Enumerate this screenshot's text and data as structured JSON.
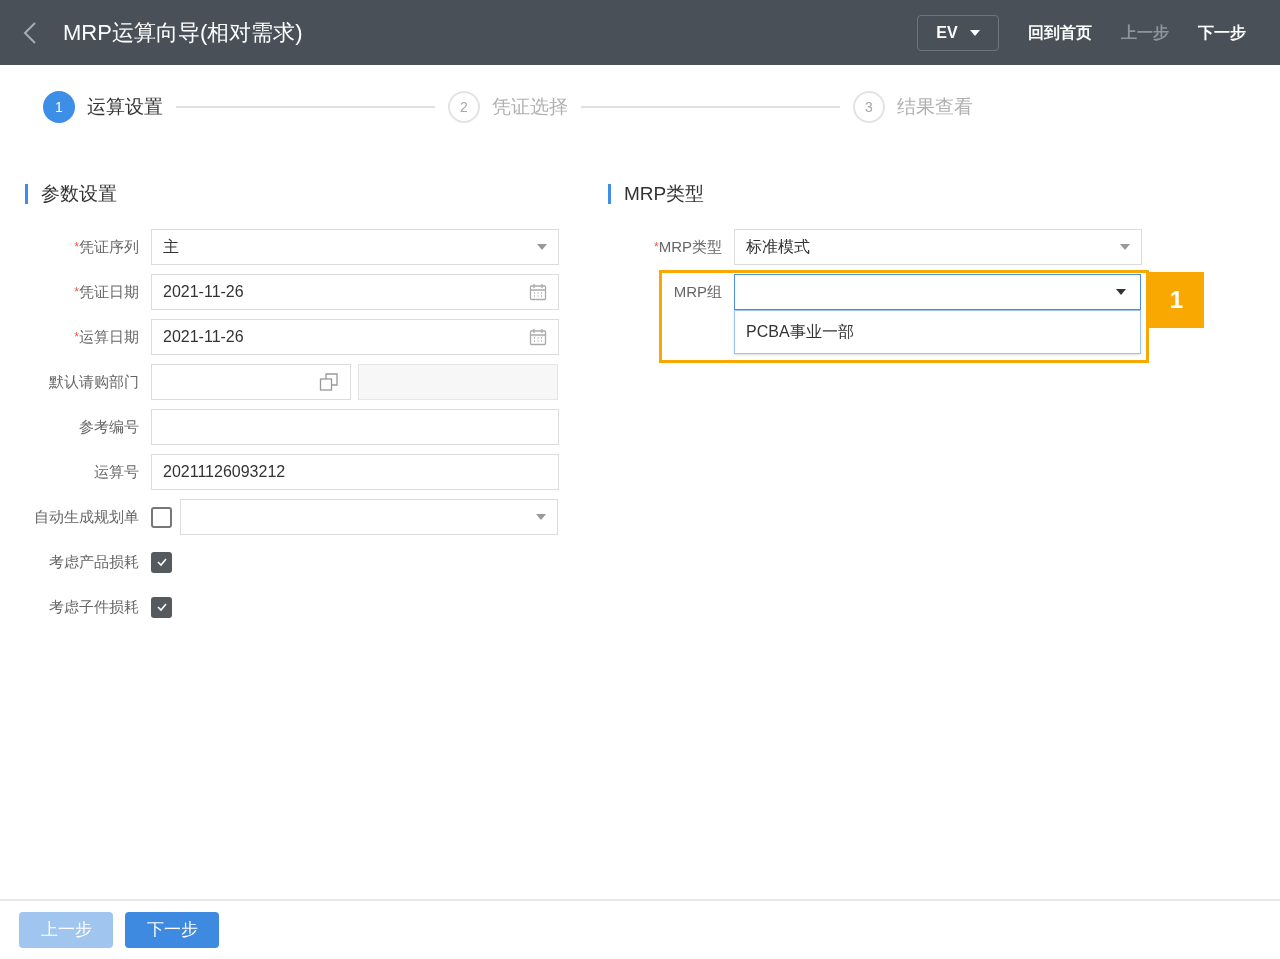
{
  "header": {
    "title": "MRP运算向导(相对需求)",
    "lang": "EV",
    "actions": [
      {
        "label": "回到首页",
        "disabled": false
      },
      {
        "label": "上一步",
        "disabled": true
      },
      {
        "label": "下一步",
        "disabled": false
      }
    ]
  },
  "steps": [
    {
      "number": "1",
      "label": "运算设置",
      "selected": true
    },
    {
      "number": "2",
      "label": "凭证选择",
      "selected": false
    },
    {
      "number": "3",
      "label": "结果查看",
      "selected": false
    }
  ],
  "params": {
    "title": "参数设置",
    "fields": [
      {
        "kind": "select",
        "label": "凭证序列",
        "required": true,
        "required_mark": "*",
        "value": "主"
      },
      {
        "kind": "date",
        "label": "凭证日期",
        "required": true,
        "required_mark": "*",
        "value": "2021-11-26"
      },
      {
        "kind": "date",
        "label": "运算日期",
        "required": true,
        "required_mark": "*",
        "value": "2021-11-26"
      },
      {
        "kind": "picker",
        "label": "默认请购部门",
        "required": false
      },
      {
        "kind": "text",
        "label": "参考编号",
        "required": false
      },
      {
        "kind": "text",
        "label": "运算号",
        "required": false,
        "value": "20211126093212"
      },
      {
        "kind": "checkselect",
        "label": "自动生成规划单",
        "required": false,
        "checked": false
      },
      {
        "kind": "check",
        "label": "考虑产品损耗",
        "required": false,
        "checked": true
      },
      {
        "kind": "check",
        "label": "考虑子件损耗",
        "required": false,
        "checked": true
      }
    ]
  },
  "mrp": {
    "title": "MRP类型",
    "fields": [
      {
        "kind": "select",
        "label": "MRP类型",
        "required": true,
        "required_mark": "*",
        "value": "标准模式"
      },
      {
        "kind": "dropdown",
        "label": "MRP组",
        "required": false,
        "options": [
          "PCBA事业一部"
        ],
        "highlight": "1"
      }
    ]
  },
  "footer": {
    "buttons": [
      {
        "label": "上一步",
        "disabled": true
      },
      {
        "label": "下一步",
        "disabled": false
      }
    ]
  }
}
